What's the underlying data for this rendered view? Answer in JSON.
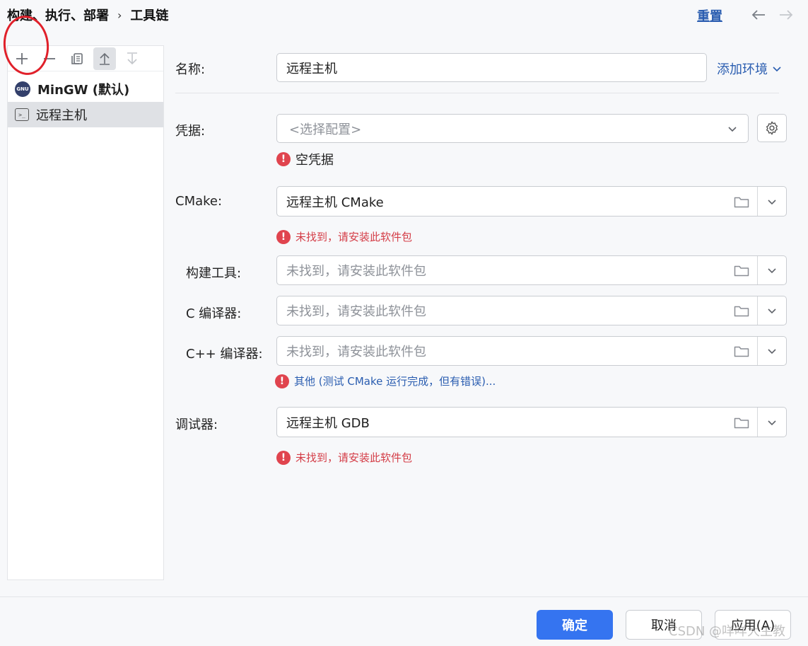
{
  "breadcrumb": {
    "part1": "构建、执行、部署",
    "part2": "工具链",
    "separator": "›"
  },
  "header": {
    "reset_label": "重置"
  },
  "toolchains": [
    {
      "label": "MinGW (默认)",
      "icon": "gnu-icon",
      "icon_text": "GNU"
    },
    {
      "label": "远程主机",
      "icon": "terminal-icon",
      "icon_text": ">_"
    }
  ],
  "form": {
    "name": {
      "label": "名称:",
      "value": "远程主机"
    },
    "add_env_label": "添加环境",
    "credentials": {
      "label": "凭据:",
      "placeholder": "<选择配置>",
      "error": "空凭据"
    },
    "cmake": {
      "label": "CMake:",
      "value": "远程主机 CMake",
      "error": "未找到，请安装此软件包"
    },
    "build_tool": {
      "label": "构建工具:",
      "placeholder": "未找到，请安装此软件包"
    },
    "c_compiler": {
      "label": "C 编译器:",
      "placeholder": "未找到，请安装此软件包"
    },
    "cpp_compiler": {
      "label": "C++ 编译器:",
      "placeholder": "未找到，请安装此软件包"
    },
    "compiler_note": "其他 (测试 CMake 运行完成，但有错误)...",
    "debugger": {
      "label": "调试器:",
      "value": "远程主机 GDB",
      "error": "未找到，请安装此软件包"
    }
  },
  "footer": {
    "ok": "确定",
    "cancel": "取消",
    "apply": "应用(A)"
  },
  "watermark": "CSDN @咩咩大主教",
  "colors": {
    "accent": "#3574f0",
    "link": "#2a5db0",
    "error": "#e0444e",
    "annotation": "#e0202a"
  }
}
